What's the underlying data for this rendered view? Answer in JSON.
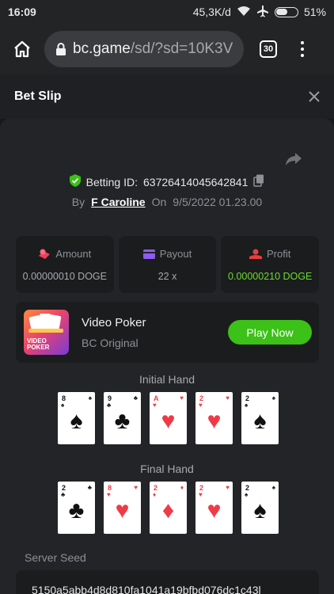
{
  "status_bar": {
    "time": "16:09",
    "speed": "45,3K/d",
    "battery": "51%"
  },
  "browser": {
    "url_host": "bc.game",
    "url_path": "/sd/?sd=10K3V",
    "tab_count": "30"
  },
  "bet_slip": {
    "title": "Bet Slip",
    "betting_id_label": "Betting ID:",
    "betting_id": "63726414045642841",
    "by_label": "By",
    "author": "F Caroline",
    "on_label": "On",
    "date": "9/5/2022 01.23.00",
    "stats": [
      {
        "label": "Amount",
        "value": "0.00000010 DOGE",
        "color": "#f0405a"
      },
      {
        "label": "Payout",
        "value": "22 x",
        "color": "#8c5cf0"
      },
      {
        "label": "Profit",
        "value": "0.00000210 DOGE",
        "color": "#ec3c3c"
      }
    ],
    "game": {
      "name": "Video Poker",
      "provider": "BC Original",
      "thumb_line1": "VIDEO",
      "thumb_line2": "POKER",
      "play_label": "Play Now"
    },
    "initial_hand_label": "Initial Hand",
    "initial_hand": [
      {
        "rank": "8",
        "suit": "♠",
        "color": "black"
      },
      {
        "rank": "9",
        "suit": "♣",
        "color": "black"
      },
      {
        "rank": "A",
        "suit": "♥",
        "color": "red"
      },
      {
        "rank": "2",
        "suit": "♥",
        "color": "red"
      },
      {
        "rank": "2",
        "suit": "♠",
        "color": "black"
      }
    ],
    "final_hand_label": "Final Hand",
    "final_hand": [
      {
        "rank": "2",
        "suit": "♣",
        "color": "black"
      },
      {
        "rank": "8",
        "suit": "♥",
        "color": "red"
      },
      {
        "rank": "2",
        "suit": "♦",
        "color": "red"
      },
      {
        "rank": "2",
        "suit": "♥",
        "color": "red"
      },
      {
        "rank": "2",
        "suit": "♠",
        "color": "black"
      }
    ],
    "server_seed_label": "Server Seed",
    "server_seed": "5150a5abb4d8d810fa1041a19bfbd076dc1c43l"
  },
  "colors": {
    "accent_green": "#3bc117",
    "profit_green": "#6bdb2e",
    "shield_green": "#3bc117"
  }
}
